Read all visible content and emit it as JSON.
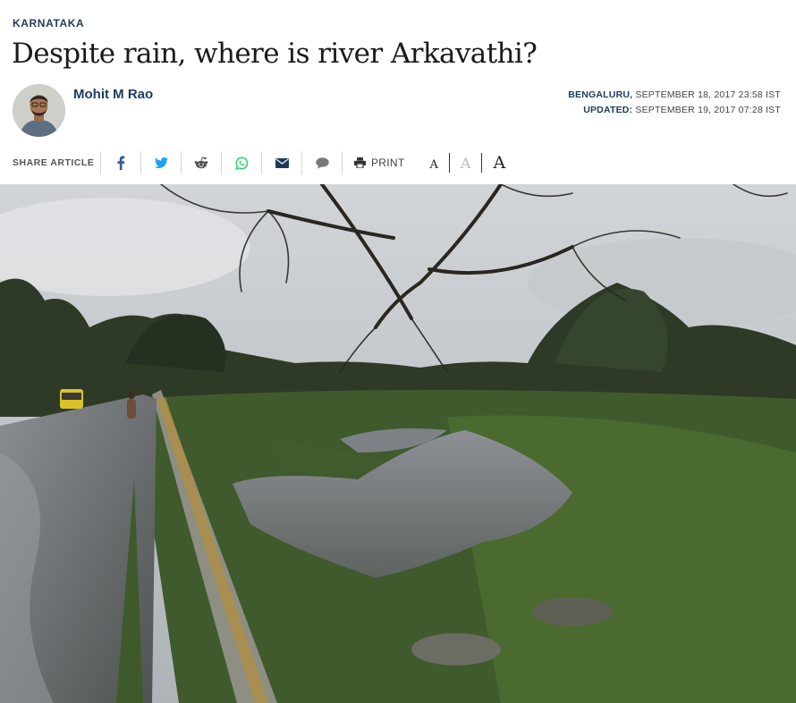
{
  "article": {
    "section": "KARNATAKA",
    "headline": "Despite rain, where is river Arkavathi?",
    "author": "Mohit M Rao",
    "location": "BENGALURU,",
    "published": "SEPTEMBER 18, 2017 23:58 IST",
    "updated_label": "UPDATED:",
    "updated": "SEPTEMBER 19, 2017 07:28 IST"
  },
  "share": {
    "label": "SHARE ARTICLE",
    "print_label": "PRINT",
    "icons": [
      "facebook-icon",
      "twitter-icon",
      "reddit-icon",
      "whatsapp-icon",
      "email-icon",
      "comment-icon",
      "print-icon"
    ],
    "font_sizes": [
      "A",
      "A",
      "A"
    ],
    "colors": {
      "facebook": "#3b5998",
      "twitter": "#1da1f2",
      "reddit": "#555555",
      "whatsapp": "#25d366",
      "email": "#1d3b5a",
      "comment": "#777777"
    }
  },
  "colors": {
    "accent": "#1d3b5a"
  }
}
